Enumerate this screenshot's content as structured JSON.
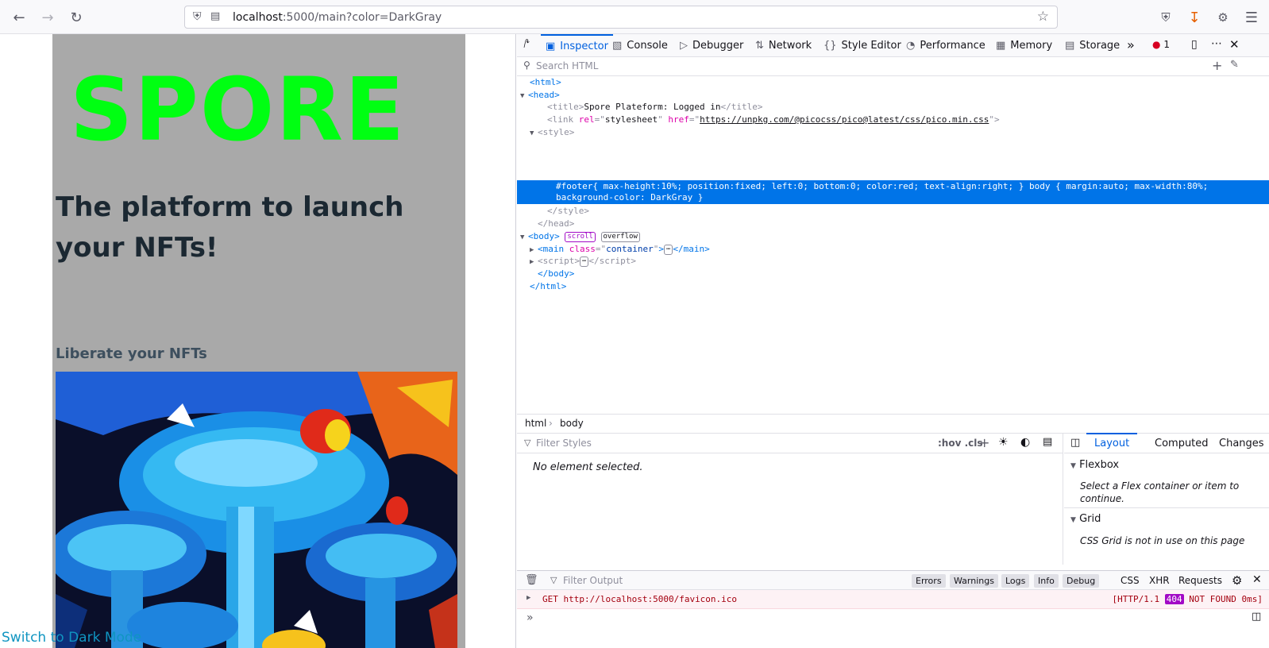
{
  "browser": {
    "url_host": "localhost",
    "url_rest": ":5000/main?color=DarkGray",
    "nav": {
      "back": "back-icon",
      "forward": "forward-icon",
      "reload": "reload-icon"
    },
    "toolbar_icons": [
      "pocket-icon",
      "download-icon",
      "extensions-icon",
      "menu-icon"
    ]
  },
  "page": {
    "background": "#a9a9a9",
    "logo_text": "SPORE",
    "logo_color": "#00ff12",
    "headline": "The platform to launch your NFTs!",
    "subheading": "Liberate your NFTs",
    "footer_link": "Switch to Dark Mode",
    "footer_color": "#1095c1"
  },
  "devtools": {
    "tabs": [
      {
        "label": "Inspector",
        "icon": "inspector-icon"
      },
      {
        "label": "Console",
        "icon": "console-icon"
      },
      {
        "label": "Debugger",
        "icon": "debugger-icon"
      },
      {
        "label": "Network",
        "icon": "network-icon"
      },
      {
        "label": "Style Editor",
        "icon": "style-editor-icon"
      },
      {
        "label": "Performance",
        "icon": "performance-icon"
      },
      {
        "label": "Memory",
        "icon": "memory-icon"
      },
      {
        "label": "Storage",
        "icon": "storage-icon"
      }
    ],
    "error_count": "1",
    "search_placeholder": "Search HTML",
    "tree": {
      "title_text": "Spore Plateform: Logged in",
      "link_rel": "stylesheet",
      "link_href": "https://unpkg.com/@picocss/pico@latest/css/pico.min.css",
      "style_text": "#footer{ max-height:10%; position:fixed; left:0; bottom:0; color:red; text-align:right; } body { margin:auto; max-width:80%;\nbackground-color: DarkGray }",
      "body_badges": [
        "scroll",
        "overflow"
      ],
      "main_class": "container"
    },
    "breadcrumbs": [
      "html",
      "body"
    ],
    "rules": {
      "filter_placeholder": "Filter Styles",
      "hov_cls": ":hov .cls",
      "empty_message": "No element selected."
    },
    "sidebar": {
      "tabs": [
        "Layout",
        "Computed",
        "Changes"
      ],
      "flexbox_title": "Flexbox",
      "flexbox_text": "Select a Flex container or item to continue.",
      "grid_title": "Grid",
      "grid_text": "CSS Grid is not in use on this page"
    },
    "console": {
      "filter_placeholder": "Filter Output",
      "filters": [
        "Errors",
        "Warnings",
        "Logs",
        "Info",
        "Debug"
      ],
      "extra_filters": [
        "CSS",
        "XHR",
        "Requests"
      ],
      "error_method": "GET",
      "error_url": "http://localhost:5000/favicon.ico",
      "error_status_prefix": "[HTTP/1.1",
      "error_code": "404",
      "error_status_suffix": "NOT FOUND 0ms]"
    }
  }
}
